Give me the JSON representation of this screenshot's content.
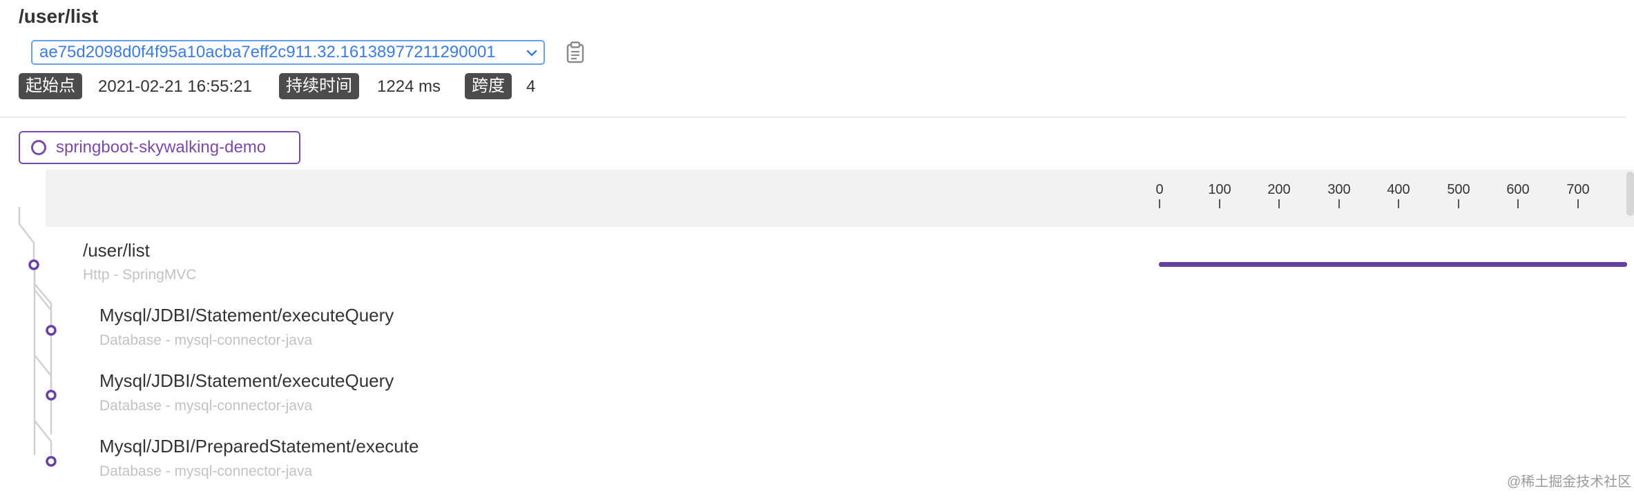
{
  "header": {
    "title": "/user/list",
    "trace_id": "ae75d2098d0f4f95a10acba7eff2c911.32.16138977211290001",
    "start_label": "起始点",
    "start_value": "2021-02-21 16:55:21",
    "duration_label": "持续时间",
    "duration_value": "1224 ms",
    "spans_label": "跨度",
    "spans_value": "4"
  },
  "service": {
    "name": "springboot-skywalking-demo"
  },
  "timeline": {
    "ticks": [
      "0",
      "100",
      "200",
      "300",
      "400",
      "500",
      "600",
      "700"
    ]
  },
  "spans": [
    {
      "title": "/user/list",
      "subtitle": "Http - SpringMVC"
    },
    {
      "title": "Mysql/JDBI/Statement/executeQuery",
      "subtitle": "Database - mysql-connector-java"
    },
    {
      "title": "Mysql/JDBI/Statement/executeQuery",
      "subtitle": "Database - mysql-connector-java"
    },
    {
      "title": "Mysql/JDBI/PreparedStatement/execute",
      "subtitle": "Database - mysql-connector-java"
    }
  ],
  "watermark": "@稀土掘金技术社区",
  "colors": {
    "accent": "#6a3fa2",
    "select_border": "#6b9ff0",
    "tag_bg": "#4c4c4c"
  },
  "icons": {
    "copy": "clipboard-icon",
    "dropdown": "chevron-down-icon",
    "service": "circle-icon"
  }
}
